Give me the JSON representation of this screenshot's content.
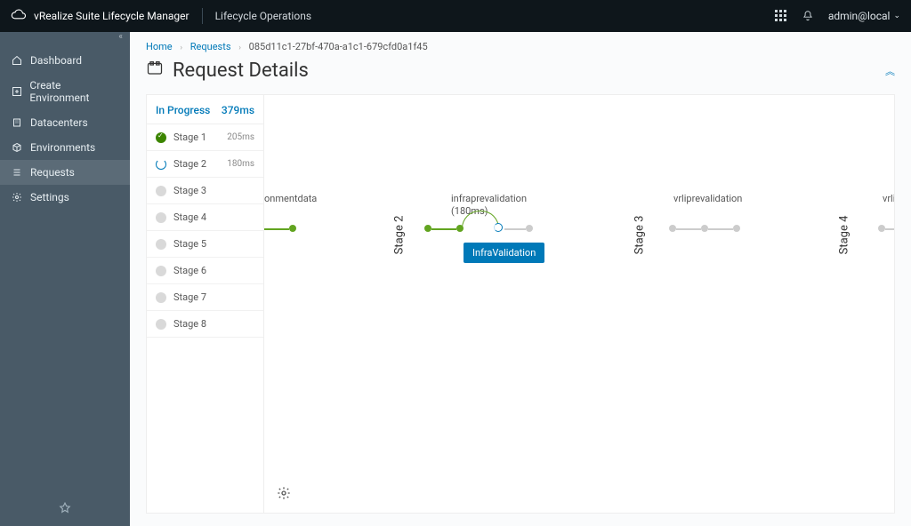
{
  "topbar": {
    "product": "vRealize Suite Lifecycle Manager",
    "section": "Lifecycle Operations",
    "user": "admin@local"
  },
  "sidebar": {
    "items": [
      {
        "label": "Dashboard",
        "icon": "home"
      },
      {
        "label": "Create Environment",
        "icon": "plus"
      },
      {
        "label": "Datacenters",
        "icon": "grid"
      },
      {
        "label": "Environments",
        "icon": "cube"
      },
      {
        "label": "Requests",
        "icon": "list"
      },
      {
        "label": "Settings",
        "icon": "gear"
      }
    ]
  },
  "breadcrumb": {
    "home": "Home",
    "requests": "Requests",
    "current": "085d11c1-27bf-470a-a1c1-679cfd0a1f45"
  },
  "page": {
    "title": "Request Details"
  },
  "stage_panel": {
    "status": "In Progress",
    "total": "379ms",
    "stages": [
      {
        "name": "Stage 1",
        "state": "done",
        "time": "205ms"
      },
      {
        "name": "Stage 2",
        "state": "running",
        "time": "180ms"
      },
      {
        "name": "Stage 3",
        "state": "idle"
      },
      {
        "name": "Stage 4",
        "state": "idle"
      },
      {
        "name": "Stage 5",
        "state": "idle"
      },
      {
        "name": "Stage 6",
        "state": "idle"
      },
      {
        "name": "Stage 7",
        "state": "idle"
      },
      {
        "name": "Stage 8",
        "state": "idle"
      }
    ]
  },
  "flow": {
    "columns": [
      {
        "v_label": "",
        "title": "onmentdata",
        "sub": "",
        "color": "green"
      },
      {
        "v_label": "Stage 2",
        "title": "infraprevalidation",
        "sub": "(180ms)",
        "badge": "InfraValidation",
        "color": "green-running"
      },
      {
        "v_label": "Stage 3",
        "title": "vrliprevalidation",
        "sub": "",
        "color": "grey"
      },
      {
        "v_label": "Stage 4",
        "title": "vrli",
        "sub": "",
        "color": "grey"
      }
    ]
  }
}
